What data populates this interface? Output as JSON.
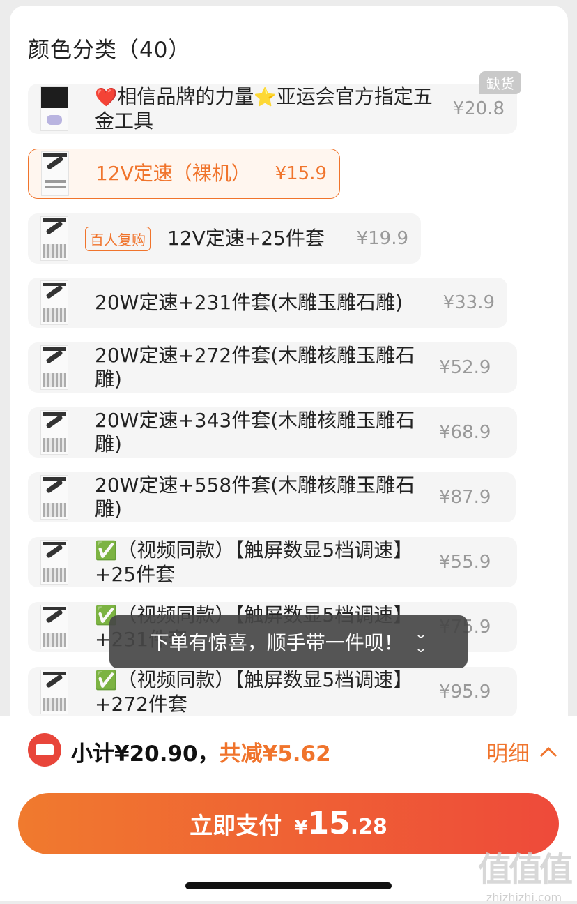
{
  "section": {
    "title": "颜色分类（40）"
  },
  "options": [
    {
      "label": "相信品牌的力量",
      "label2": "亚运会官方指定五金工具",
      "lead_emoji": "❤️",
      "mid_emoji": "⭐",
      "price": "¥20.8",
      "badge": "缺货",
      "selected": false
    },
    {
      "label": "12V定速（裸机）",
      "price": "¥15.9",
      "selected": true
    },
    {
      "tag": "百人复购",
      "label": "12V定速+25件套",
      "price": "¥19.9",
      "selected": false
    },
    {
      "label": "20W定速+231件套(木雕玉雕石雕)",
      "price": "¥33.9",
      "selected": false
    },
    {
      "label": "20W定速+272件套(木雕核雕玉雕石雕)",
      "price": "¥52.9",
      "selected": false
    },
    {
      "label": "20W定速+343件套(木雕核雕玉雕石雕)",
      "price": "¥68.9",
      "selected": false
    },
    {
      "label": "20W定速+558件套(木雕核雕玉雕石雕)",
      "price": "¥87.9",
      "selected": false
    },
    {
      "lead_emoji": "✅",
      "label": "（视频同款）【触屏数显5档调速】+25件套",
      "price": "¥55.9",
      "selected": false
    },
    {
      "lead_emoji": "✅",
      "label": "（视频同款）【触屏数显5档调速】+231件套",
      "price": "¥75.9",
      "selected": false
    },
    {
      "lead_emoji": "✅",
      "label": "（视频同款）【触屏数显5档调速】+272件套",
      "price": "¥95.9",
      "selected": false
    }
  ],
  "toast": {
    "text": "下单有惊喜，顺手带一件呗！",
    "icon": "chevron-double-down-icon"
  },
  "summary": {
    "subtotal": "小计¥20.90，",
    "discount": "共减¥5.62",
    "detail_label": "明细",
    "detail_icon": "chevron-up-icon"
  },
  "pay_button": {
    "label": "立即支付",
    "currency": "¥",
    "amount_int": "15",
    "amount_dec": ".28"
  },
  "watermark": {
    "logo": "值值值",
    "url": "zhizhizhi.com"
  },
  "colors": {
    "accent": "#f0742c",
    "red": "#ee4a3a",
    "muted": "#999999"
  }
}
